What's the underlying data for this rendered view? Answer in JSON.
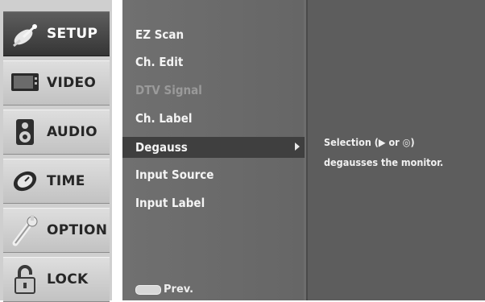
{
  "sidebar": {
    "items": [
      {
        "label": "SETUP",
        "icon": "satellite-dish-icon",
        "active": true
      },
      {
        "label": "VIDEO",
        "icon": "monitor-icon",
        "active": false
      },
      {
        "label": "AUDIO",
        "icon": "speaker-icon",
        "active": false
      },
      {
        "label": "TIME",
        "icon": "clock-icon",
        "active": false
      },
      {
        "label": "OPTION",
        "icon": "wrench-icon",
        "active": false
      },
      {
        "label": "LOCK",
        "icon": "padlock-icon",
        "active": false
      }
    ]
  },
  "menu": {
    "items": [
      {
        "label": "EZ Scan"
      },
      {
        "label": "Ch. Edit"
      },
      {
        "label": "DTV Signal",
        "disabled": true
      },
      {
        "label": "Ch. Label"
      },
      {
        "label": "Degauss",
        "selected": true
      },
      {
        "label": "Input Source"
      },
      {
        "label": "Input Label"
      }
    ],
    "prev_label": "Prev."
  },
  "info": {
    "line1": "Selection (▶ or ◎)",
    "line2": "degausses the monitor."
  }
}
